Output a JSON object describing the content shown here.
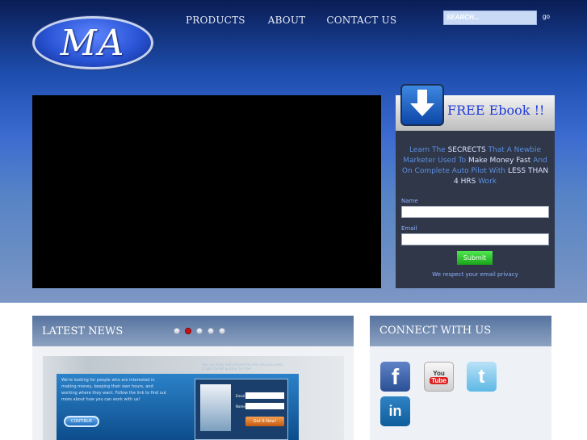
{
  "logo": {
    "text": "MA"
  },
  "nav": {
    "items": [
      {
        "label": "PRODUCTS"
      },
      {
        "label": "ABOUT"
      },
      {
        "label": "CONTACT US"
      }
    ]
  },
  "search": {
    "placeholder": "SEARCH...",
    "go_label": "go"
  },
  "ebook": {
    "title": "FREE Ebook !!",
    "pitch": {
      "p1": "Learn The ",
      "p2": "SECRECTS",
      "p3": " That A Newbie Marketer Used To ",
      "p4": "Make Money Fast",
      "p5": " And On Complete Auto Pilot With ",
      "p6": "LESS THAN 4 HRS",
      "p7": " Work"
    },
    "name_label": "Name",
    "email_label": "Email",
    "submit_label": "Submit",
    "privacy": "We respect your email privacy"
  },
  "news": {
    "title": "LATEST NEWS",
    "slider_dot_count": 5,
    "active_dot": 2,
    "slide": {
      "intro": "We're looking for people who are interested in making money, keeping their own hours, and working where they want. Follow the link to find out more about how you can work with us!",
      "continue_label": "CONTINUE",
      "top_text": "Sign up today and receive the only step you need to get started quickly. Try free!",
      "email_label": "Email",
      "name_label": "Name",
      "cta_label": "Get It Now!"
    }
  },
  "connect": {
    "title": "CONNECT WITH US",
    "icons": [
      {
        "name": "facebook-icon",
        "glyph": "f"
      },
      {
        "name": "youtube-icon",
        "top": "You",
        "bottom": "Tube"
      },
      {
        "name": "twitter-icon",
        "glyph": "t"
      },
      {
        "name": "linkedin-icon",
        "glyph": "in"
      }
    ]
  },
  "colors": {
    "header_gradient_top": "#0a1d55",
    "header_gradient_bottom": "#7d97c5",
    "ebook_panel": "#2f3749",
    "link_blue": "#5c8fe0",
    "submit_green": "#22b822"
  }
}
